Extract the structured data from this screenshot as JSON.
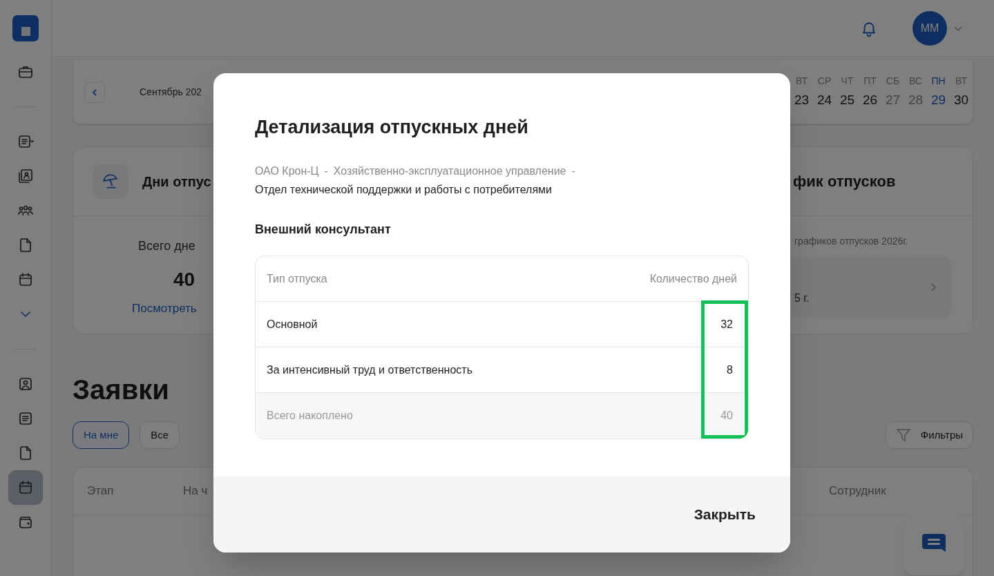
{
  "sidebar": {
    "items": [
      {
        "kind": "icon",
        "selected": false
      },
      {
        "kind": "divider"
      },
      {
        "kind": "icon",
        "selected": false
      },
      {
        "kind": "icon",
        "selected": false
      },
      {
        "kind": "icon",
        "selected": false
      },
      {
        "kind": "icon",
        "selected": false
      },
      {
        "kind": "icon",
        "selected": false
      },
      {
        "kind": "icon",
        "selected": false
      },
      {
        "kind": "divider"
      },
      {
        "kind": "icon",
        "selected": false
      },
      {
        "kind": "icon",
        "selected": false
      },
      {
        "kind": "icon",
        "selected": false
      },
      {
        "kind": "icon",
        "selected": true
      },
      {
        "kind": "icon",
        "selected": false
      }
    ]
  },
  "header": {
    "avatar": "ММ"
  },
  "calendar_strip": {
    "month": "Сентябрь 202",
    "days": [
      {
        "weekday": "ВТ",
        "date": "23",
        "weekend": false,
        "selected": false
      },
      {
        "weekday": "СР",
        "date": "24",
        "weekend": false,
        "selected": false
      },
      {
        "weekday": "ЧТ",
        "date": "25",
        "weekend": false,
        "selected": false
      },
      {
        "weekday": "ПТ",
        "date": "26",
        "weekend": false,
        "selected": false
      },
      {
        "weekday": "СБ",
        "date": "27",
        "weekend": true,
        "selected": false
      },
      {
        "weekday": "ВС",
        "date": "28",
        "weekend": true,
        "selected": false
      },
      {
        "weekday": "ПН",
        "date": "29",
        "weekend": false,
        "selected": true
      },
      {
        "weekday": "ВТ",
        "date": "30",
        "weekend": false,
        "selected": false
      }
    ]
  },
  "vacation_card": {
    "title": "Дни отпус",
    "label": "Всего дне",
    "value": "40",
    "link": "Посмотреть"
  },
  "schedule_card": {
    "title": "фик отпусков",
    "subtitle": "графиков отпусков 2026г.",
    "item": "5 г."
  },
  "requests": {
    "title": "Заявки",
    "tabs": [
      {
        "label": "На мне",
        "selected": true
      },
      {
        "label": "Все",
        "selected": false
      }
    ],
    "filter_button": "Фильтры",
    "columns": [
      "Этап",
      "На ч",
      "Сотрудник"
    ]
  },
  "modal": {
    "title": "Детализация отпускных дней",
    "org_path": [
      {
        "text": "ОАО Крон-Ц",
        "kind": "unit"
      },
      {
        "text": "-",
        "kind": "separator"
      },
      {
        "text": "Хозяйственно-эксплуатационное управление",
        "kind": "unit"
      },
      {
        "text": "-",
        "kind": "separator"
      },
      {
        "text": "Отдел технической поддержки и работы с потребителями",
        "kind": "current"
      }
    ],
    "position": "Внешний консультант",
    "table": {
      "columns": [
        "Тип отпуска",
        "Количество дней"
      ],
      "rows": [
        {
          "type": "Основной",
          "days": "32",
          "total": false
        },
        {
          "type": "За интенсивный труд и ответственность",
          "days": "8",
          "total": false
        },
        {
          "type": "Всего накоплено",
          "days": "40",
          "total": true
        }
      ],
      "highlight": {
        "color": "#12c058"
      }
    },
    "close_button": "Закрыть"
  }
}
